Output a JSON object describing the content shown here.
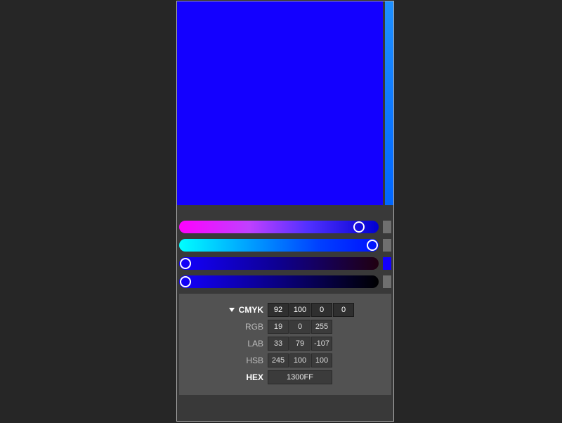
{
  "colors": {
    "current": "#1300FF",
    "vertical_strip": "#1e90ff"
  },
  "sliders": {
    "cyan": {
      "position_pct": 90,
      "sample_color": "#6f6f6f"
    },
    "magenta": {
      "position_pct": 97,
      "sample_color": "#6f6f6f"
    },
    "yellow": {
      "position_pct": 3,
      "sample_color": "#1300ff"
    },
    "key": {
      "position_pct": 3,
      "sample_color": "#6f6f6f"
    }
  },
  "value_rows": {
    "cmyk": {
      "label": "CMYK",
      "values": [
        "92",
        "100",
        "0",
        "0"
      ],
      "active": true
    },
    "rgb": {
      "label": "RGB",
      "values": [
        "19",
        "0",
        "255"
      ]
    },
    "lab": {
      "label": "LAB",
      "values": [
        "33",
        "79",
        "-107"
      ]
    },
    "hsb": {
      "label": "HSB",
      "values": [
        "245",
        "100",
        "100"
      ]
    },
    "hex": {
      "label": "HEX",
      "value": "1300FF"
    }
  }
}
